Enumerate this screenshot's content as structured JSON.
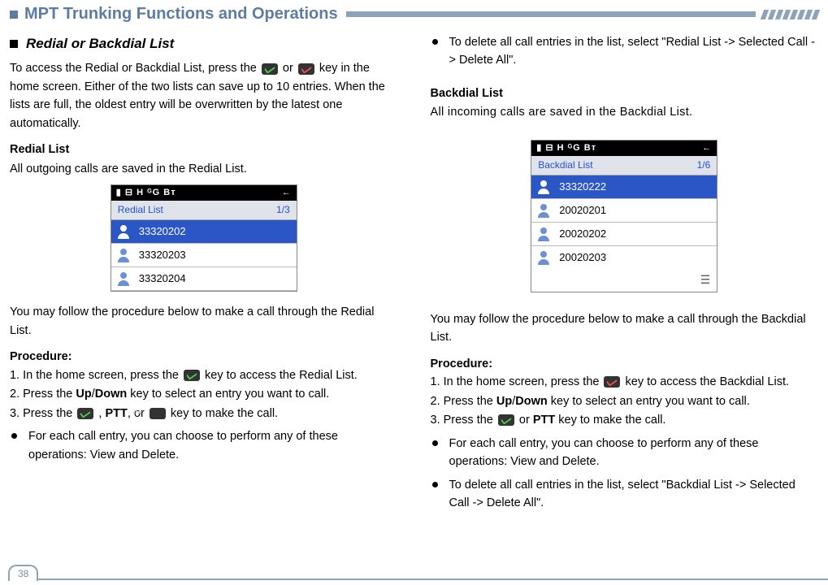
{
  "header": {
    "title": "MPT Trunking Functions and Operations"
  },
  "left": {
    "section_heading": "Redial or Backdial List",
    "intro_1": "To access the Redial or Backdial List, press the ",
    "intro_2": " or ",
    "intro_3": " key in the home screen. Either of the two lists can save up to 10 entries. When the lists are full, the oldest entry will be overwritten by the latest one automatically.",
    "redial_heading": "Redial List",
    "redial_desc": "All outgoing calls are saved in the Redial List.",
    "screenshot1": {
      "statusbar_left": "▮ ⊟ H   ᴳG    Bᴛ",
      "statusbar_right": "←",
      "list_title": "Redial List",
      "list_count": "1/3",
      "rows": [
        "33320202",
        "33320203",
        "33320204"
      ]
    },
    "follow_text": "You may follow the procedure below to make a call through the Redial List.",
    "procedure_label": "Procedure:",
    "step1_a": "1.  In the home screen, press the ",
    "step1_b": " key to access the Redial List.",
    "step2_a": "2.  Press the ",
    "step2_updown": "Up",
    "step2_slash": "/",
    "step2_down": "Down",
    "step2_b": " key to select an entry you want to call.",
    "step3_a": "3.  Press the ",
    "step3_b": " , ",
    "step3_ptt": "PTT",
    "step3_c": ", or ",
    "step3_d": " key to make the call.",
    "bullet1": "For each call entry, you can choose to perform any of these operations: View and Delete."
  },
  "right": {
    "bullet_top": "To delete all call entries in the list, select \"Redial List -> Selected Call -> Delete All\".",
    "backdial_heading": "Backdial List",
    "backdial_desc": "All incoming calls are saved in the Backdial List.",
    "screenshot2": {
      "statusbar_left": "▮ ⊟ H   ᴳG    Bᴛ",
      "statusbar_right": "←",
      "list_title": "Backdial List",
      "list_count": "1/6",
      "rows": [
        "33320222",
        "20020201",
        "20020202",
        "20020203"
      ],
      "bottom_icon": "☰"
    },
    "follow_text": "You may follow the procedure below to make a call through the Backdial List.",
    "procedure_label": "Procedure:",
    "step1_a": "1.  In the home screen, press the ",
    "step1_b": " key to access the Backdial List.",
    "step2_a": "2.  Press the ",
    "step2_updown": "Up",
    "step2_slash": "/",
    "step2_down": "Down",
    "step2_b": " key to select an entry you want to call.",
    "step3_a": "3.  Press the ",
    "step3_b": " or ",
    "step3_ptt": "PTT",
    "step3_c": " key to make the call.",
    "bullet1": "For each call entry, you can choose to perform any of these operations: View and Delete.",
    "bullet2": "To delete all call entries in the list, select \"Backdial List -> Selected Call -> Delete All\"."
  },
  "page_number": "38"
}
